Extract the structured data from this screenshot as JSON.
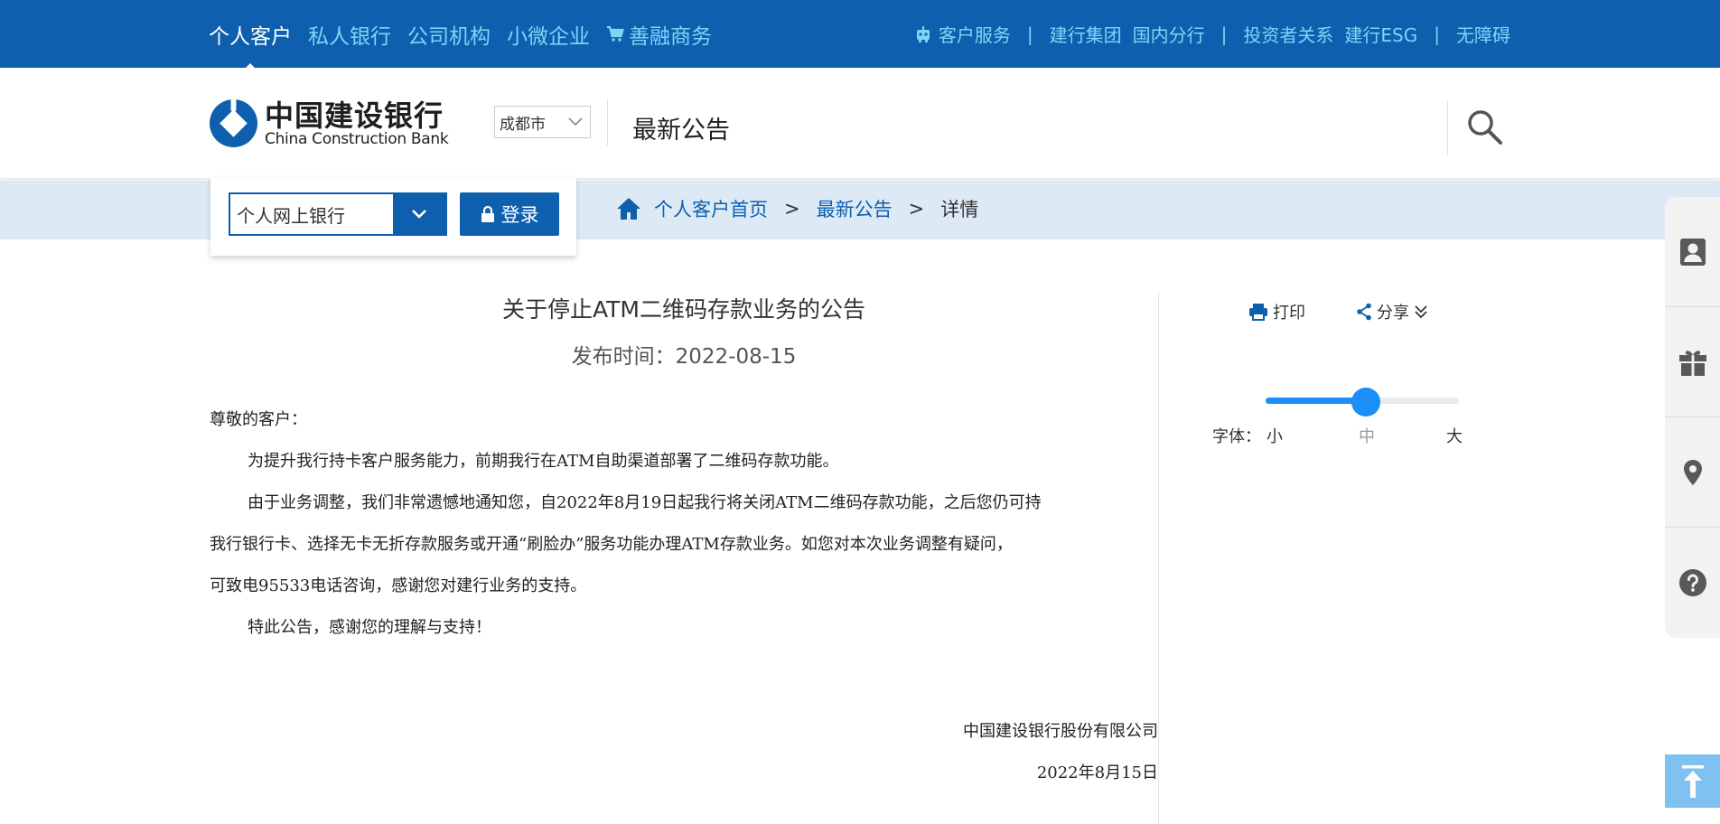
{
  "topnav": {
    "left": [
      {
        "label": "个人客户",
        "active": true
      },
      {
        "label": "私人银行",
        "active": false
      },
      {
        "label": "公司机构",
        "active": false
      },
      {
        "label": "小微企业",
        "active": false
      },
      {
        "label": "善融商务",
        "active": false
      }
    ],
    "right": {
      "customer_service": "客户服务",
      "group": "建行集团",
      "domestic": "国内分行",
      "investor": "投资者关系",
      "esg": "建行ESG",
      "accessibility": "无障碍",
      "separator": "|"
    }
  },
  "header": {
    "logo_cn": "中国建设银行",
    "logo_en": "China Construction Bank",
    "city": "成都市",
    "page_heading": "最新公告"
  },
  "login": {
    "select_value": "个人网上银行",
    "button_label": "登录"
  },
  "breadcrumb": {
    "home": "个人客户首页",
    "section": "最新公告",
    "current": "详情",
    "separator": ">"
  },
  "article": {
    "title": "关于停止ATM二维码存款业务的公告",
    "date": "发布时间：2022-08-15",
    "lines": [
      "尊敬的客户：",
      "为提升我行持卡客户服务能力，前期我行在ATM自助渠道部署了二维码存款功能。",
      "由于业务调整，我们非常遗憾地通知您，自2022年8月19日起我行将关闭ATM二维码存款功能，之后您仍可持",
      "我行银行卡、选择无卡无折存款服务或开通“刷脸办”服务功能办理ATM存款业务。如您对本次业务调整有疑问，",
      "可致电95533电话咨询，感谢您对建行业务的支持。",
      "特此公告，感谢您的理解与支持！"
    ],
    "signature_org": "中国建设银行股份有限公司",
    "signature_date": "2022年8月15日"
  },
  "tools": {
    "print": "打印",
    "share": "分享",
    "font_label": "字体：",
    "font_small": "小",
    "font_medium": "中",
    "font_large": "大",
    "font_level": 0.52
  },
  "colors": {
    "brand_blue": "#0e5fae",
    "nav_link": "#7fd4f7",
    "crumb_bg": "#ddeaf6",
    "slider_blue": "#1a8ff5"
  },
  "sidebar_icons": [
    "user-card-icon",
    "gift-icon",
    "location-pin-icon",
    "help-icon"
  ]
}
